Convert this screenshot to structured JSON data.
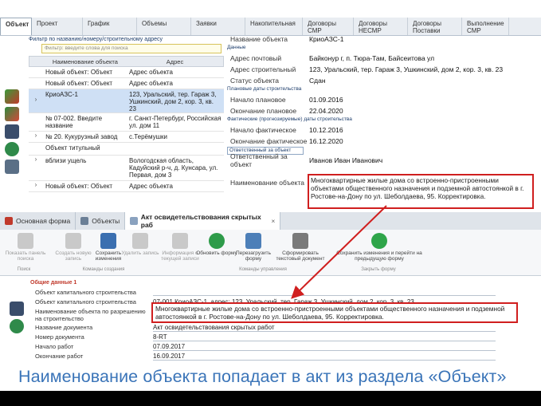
{
  "top_tabs": [
    "Объект",
    "Проект",
    "График",
    "Объемы",
    "Заявки",
    "Накопительная",
    "Договоры СМР",
    "Договоры НЕСМР",
    "Договоры Поставки",
    "Выполнение СМР"
  ],
  "filter": {
    "label": "Фильтр по названию/номеру/строительному адресу",
    "placeholder": "Фильтр: введите слова для поиска"
  },
  "grid": {
    "col_name": "Наименование объекта",
    "col_addr": "Адрес",
    "rows": [
      {
        "name": "Новый объект: Объект",
        "addr": "Адрес объекта"
      },
      {
        "name": "Новый объект: Объект",
        "addr": "Адрес объекта"
      },
      {
        "name": "КриоАЗС-1",
        "addr": "123, Уральский, тер. Гараж 3, Ушкинский, дом 2, кор. 3, кв. 23"
      },
      {
        "name": "№ 07-002. Введите название",
        "addr": "г. Санкт-Петербург, Российская ул. дом 11"
      },
      {
        "name": "№ 20. Кукурузный завод",
        "addr": "с.Терёмушки"
      },
      {
        "name": "Объект титульный",
        "addr": ""
      },
      {
        "name": "вблизи ущель",
        "addr": "Вологодская область, Кадуйский р-ч, д. Кунсара, ул. Первая, дом 3"
      },
      {
        "name": "Новый объект: Объект",
        "addr": "Адрес объекта"
      }
    ]
  },
  "details": {
    "name_label": "Название объекта",
    "name_value": "КриоАЗС-1",
    "group_data": "Данные",
    "postal_label": "Адрес почтовый",
    "postal_value": "Байконур г, п. Тюра-Там, Байсеитова ул",
    "build_label": "Адрес строительный",
    "build_value": "123, Уральский, тер. Гараж 3, Ушкинский, дом 2, кор. 3, кв. 23",
    "status_label": "Статус объекта",
    "status_value": "Сдан",
    "group_plan": "Плановые даты строительства",
    "plan_start_label": "Начало плановое",
    "plan_start_value": "01.09.2016",
    "plan_end_label": "Окончание плановое",
    "plan_end_value": "22.04.2020",
    "group_fact": "Фактические (прогнозируемые) даты строительства",
    "fact_start_label": "Начало фактическое",
    "fact_start_value": "10.12.2016",
    "fact_end_label": "Окончание фактическое",
    "fact_end_value": "16.12.2020",
    "group_resp": "Ответственный за объект",
    "resp_label": "Ответственный за объект",
    "resp_value": "Иванов Иван Иванович",
    "desc_label": "Наименование объекта",
    "desc_value": "Многоквартирные жилые дома со встроенно-пристроенными объектами общественного назначения и подземной автостоянкой в г. Ростове-на-Дону по ул. Шеболдаева, 95. Корректировка."
  },
  "doc_tabs": {
    "main_form": "Основная форма",
    "objects": "Объекты",
    "act": "Акт освидетельствования скрытых раб",
    "close": "×"
  },
  "ribbon": {
    "show_search": "Показать панель поиска",
    "create": "Создать новую запись",
    "save": "Сохранить изменения",
    "delete": "Удалить запись",
    "info": "Информация о текущей записи",
    "refresh": "Обновить форму",
    "reload": "Перезагрузить форму",
    "print": "Сформировать текстовый документ",
    "save_back": "Сохранить изменения и перейти на предыдущую форму",
    "group_search": "Поиск",
    "group_create": "Команды создания",
    "group_manage": "Команды управления",
    "group_close": "Закрыть форму"
  },
  "form": {
    "section": "Общие данные 1",
    "cap_label": "Объект капитального строительства",
    "cap2_label": "Объект капитального строительства",
    "cap2_value": "07-001 КриоАЗС-1, адрес: 123, Уральский, тер. Гараж 3, Ушкинский, дом 2, кор. 3, кв. 23",
    "permit_label": "Наименование объекта по разрешению на строительство",
    "permit_value": "Многоквартирные жилые дома со встроенно-пристроенными объектами общественного назначения и подземной автостоянкой в г. Ростове-на-Дону по ул. Шеболдаева, 95. Корректировка.",
    "doc_name_label": "Название документа",
    "doc_name_value": "Акт освидетельствования скрытых работ",
    "doc_num_label": "Номер документа",
    "doc_num_value": "8-RT",
    "start_label": "Начало работ",
    "start_value": "07.09.2017",
    "end_label": "Окончание работ",
    "end_value": "16.09.2017"
  },
  "caption": "Наименование объекта попадает в акт из раздела «Объект»",
  "colors": {
    "highlight_border": "#d01f1f",
    "caption": "#3a74b8",
    "selection": "#cfe0f5"
  }
}
